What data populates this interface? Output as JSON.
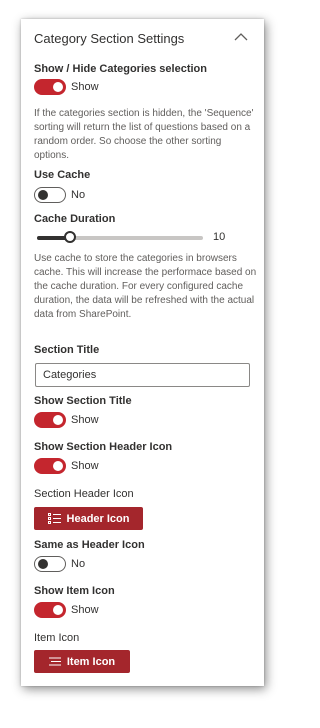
{
  "panel": {
    "title": "Category Section Settings",
    "collapse_icon": "chevron-up-icon"
  },
  "show_hide_categories": {
    "label": "Show / Hide Categories selection",
    "state": "Show",
    "on": true
  },
  "categories_description": "If the categories section is hidden, the 'Sequence' sorting will return the list of questions based on a random order. So choose the other sorting options.",
  "use_cache": {
    "label": "Use Cache",
    "state": "No",
    "on": false
  },
  "cache_duration": {
    "label": "Cache Duration",
    "value": "10"
  },
  "cache_description": "Use cache to store the categories in browsers cache. This will increase the performace based on the cache duration. For every configured cache duration, the data will be refreshed with the actual data from SharePoint.",
  "section_title": {
    "label": "Section Title",
    "value": "Categories"
  },
  "show_section_title": {
    "label": "Show Section Title",
    "state": "Show",
    "on": true
  },
  "show_section_header_icon": {
    "label": "Show Section Header Icon",
    "state": "Show",
    "on": true
  },
  "section_header_icon": {
    "label": "Section Header Icon",
    "button_label": "Header Icon",
    "icon": "bulleted-list-icon"
  },
  "same_as_header_icon": {
    "label": "Same as Header Icon",
    "state": "No",
    "on": false
  },
  "show_item_icon": {
    "label": "Show Item Icon",
    "state": "Show",
    "on": true
  },
  "item_icon": {
    "label": "Item Icon",
    "button_label": "Item Icon",
    "icon": "lines-icon"
  },
  "colors": {
    "accent": "#a4262c",
    "toggle_on": "#c4262e",
    "text": "#323130",
    "muted_text": "#605e5c"
  }
}
